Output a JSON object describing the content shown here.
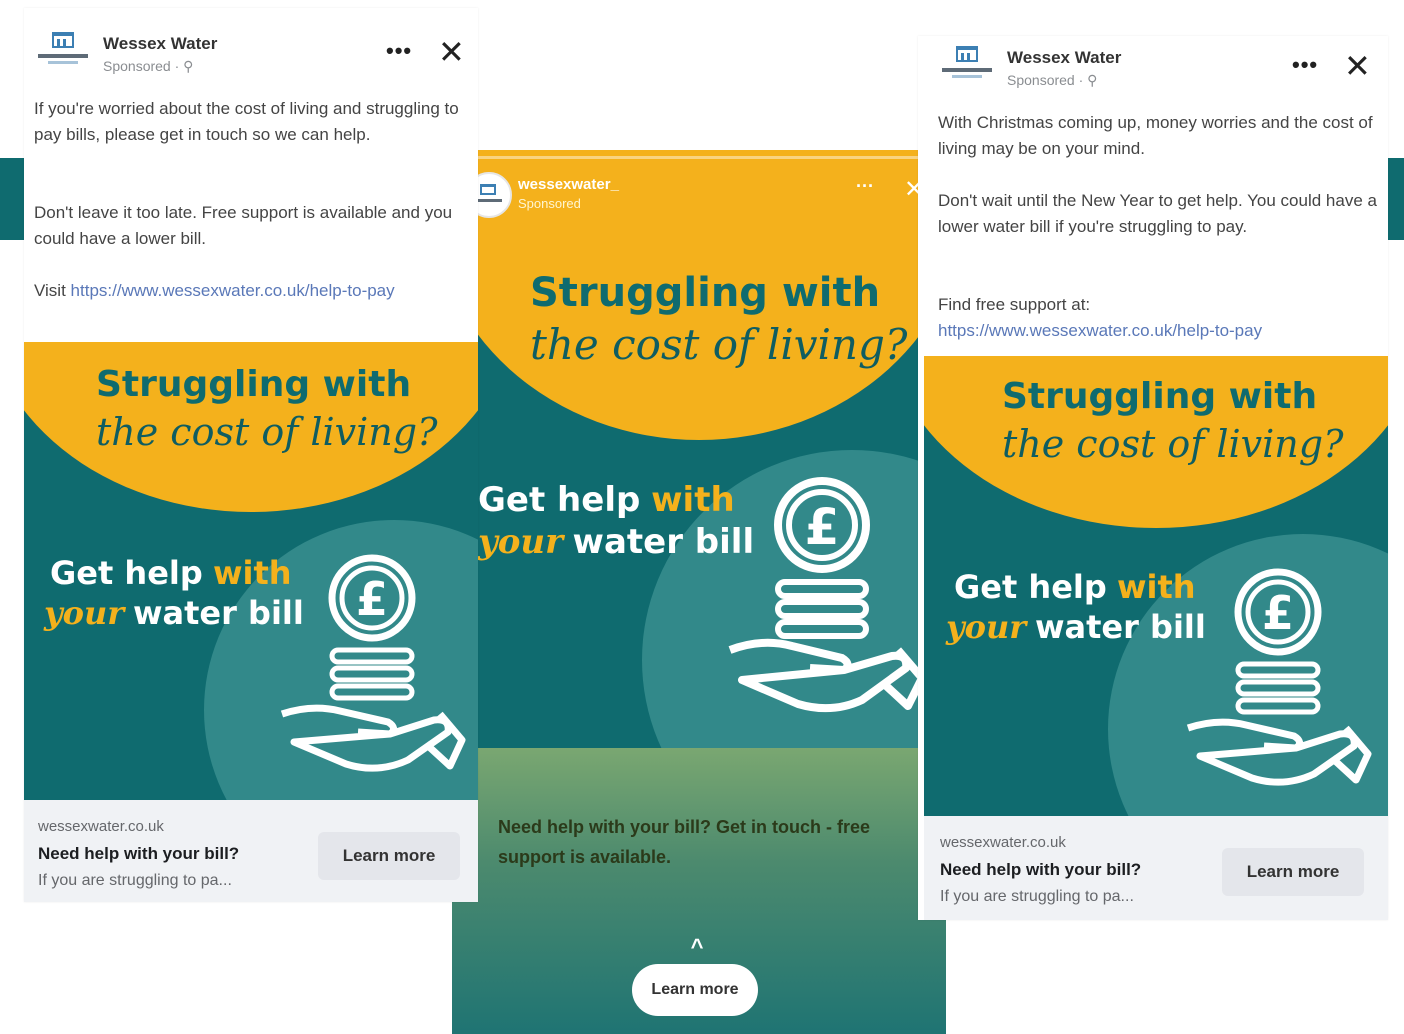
{
  "page": {
    "background": "#ffffff",
    "teal": "#0f6b6f",
    "yellow": "#f4b11c"
  },
  "left_post": {
    "page_name": "Wessex Water",
    "sponsored": "Sponsored · ⚲",
    "more_icon": "more-icon",
    "close_icon": "close-icon",
    "para1": "If you're worried about the cost of living and struggling to pay bills, please get in touch so we can help.",
    "para2": "Don't leave it too late. Free support is available and you could have a lower bill.",
    "visit_label": "Visit",
    "link": "https://www.wessexwater.co.uk/help-to-pay",
    "creative": {
      "headline_top": "Struggling with",
      "headline_script": "the cost of living?",
      "get_help": "Get help",
      "with": "with",
      "your": "your",
      "water_bill": "water bill"
    },
    "domain": "wessexwater.co.uk",
    "headline": "Need help with your bill?",
    "description": "If you are struggling to pa...",
    "cta": "Learn more"
  },
  "story": {
    "account": "wessexwater_",
    "sponsored": "Sponsored",
    "more": "···",
    "creative": {
      "headline_top": "Struggling with",
      "headline_script": "the cost of living?",
      "get_help": "Get help",
      "with": "with",
      "your": "your",
      "water_bill": "water bill"
    },
    "caption": "Need help with your bill? Get in touch - free support is available.",
    "chevron": "^",
    "cta": "Learn more"
  },
  "right_post": {
    "page_name": "Wessex Water",
    "sponsored": "Sponsored · ⚲",
    "para1": "With Christmas coming up, money worries and the cost of living may be on your mind.",
    "para2": "Don't wait until the New Year to get help. You could have a lower water bill if you're struggling to pay.",
    "para3": "Find free support at:",
    "link": "https://www.wessexwater.co.uk/help-to-pay",
    "creative": {
      "headline_top": "Struggling with",
      "headline_script": "the cost of living?",
      "get_help": "Get help",
      "with": "with",
      "your": "your",
      "water_bill": "water bill"
    },
    "domain": "wessexwater.co.uk",
    "headline": "Need help with your bill?",
    "description": "If you are struggling to pa...",
    "cta": "Learn more"
  }
}
